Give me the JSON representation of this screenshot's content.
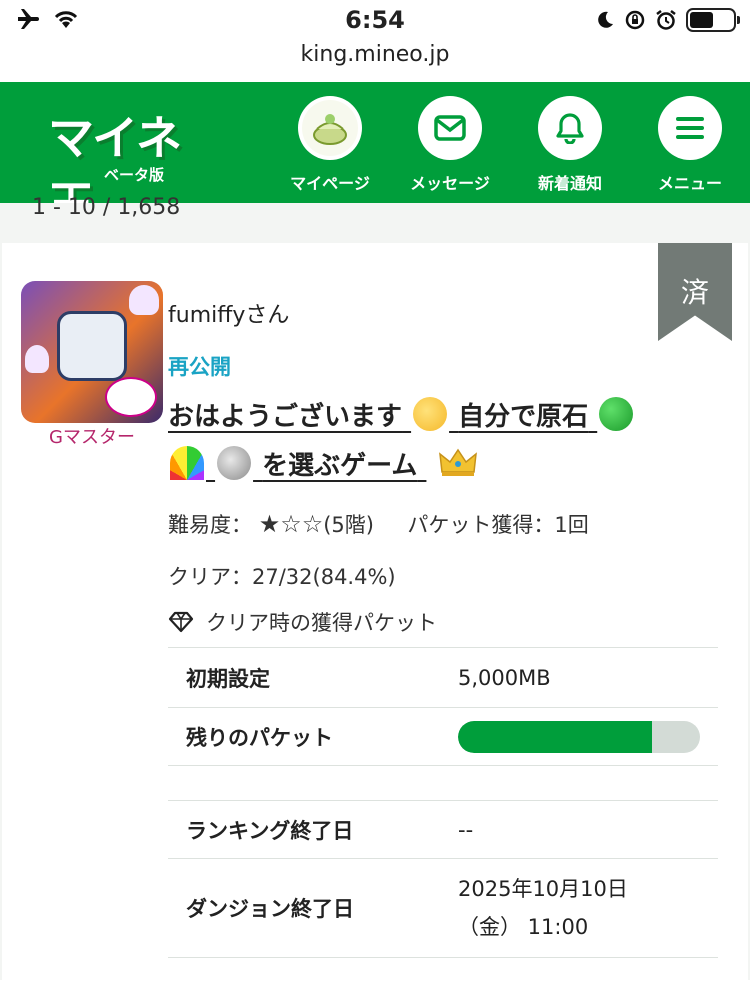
{
  "status": {
    "time": "6:54",
    "url": "king.mineo.jp"
  },
  "header": {
    "logo": "マイネ王",
    "logo_sub": "ベータ版",
    "nav": [
      {
        "label": "マイページ",
        "icon": "avatar-icon"
      },
      {
        "label": "メッセージ",
        "icon": "mail-icon"
      },
      {
        "label": "新着通知",
        "icon": "bell-icon"
      },
      {
        "label": "メニュー",
        "icon": "menu-icon"
      }
    ]
  },
  "list": {
    "count": "1 - 10 / 1,658"
  },
  "game": {
    "done_tag": "済",
    "badge": "Gマスター",
    "username": "fumiffyさん",
    "status": "再公開",
    "title_line1": "おはようございます",
    "title_mid": "自分で原石",
    "title_line2": "を選ぶゲーム",
    "difficulty_label": "難易度：",
    "difficulty_stars": "★☆☆",
    "difficulty_level": "(5階)",
    "packet_gain": "パケット獲得：1回",
    "clear": "クリア：27/32(84.4%)",
    "packet_header": "クリア時の獲得パケット",
    "rows": [
      {
        "label": "初期設定",
        "value": "5,000MB"
      },
      {
        "label": "残りのパケット",
        "value": ""
      },
      {
        "label": "ランキング終了日",
        "value": "--"
      },
      {
        "label": "ダンジョン終了日",
        "value": "2025年10月10日（金） 11:00"
      }
    ],
    "remaining_fraction": 0.8
  },
  "colors": {
    "brand": "#009e3b",
    "accent": "#1aa3c4",
    "badge": "#b5266b"
  }
}
